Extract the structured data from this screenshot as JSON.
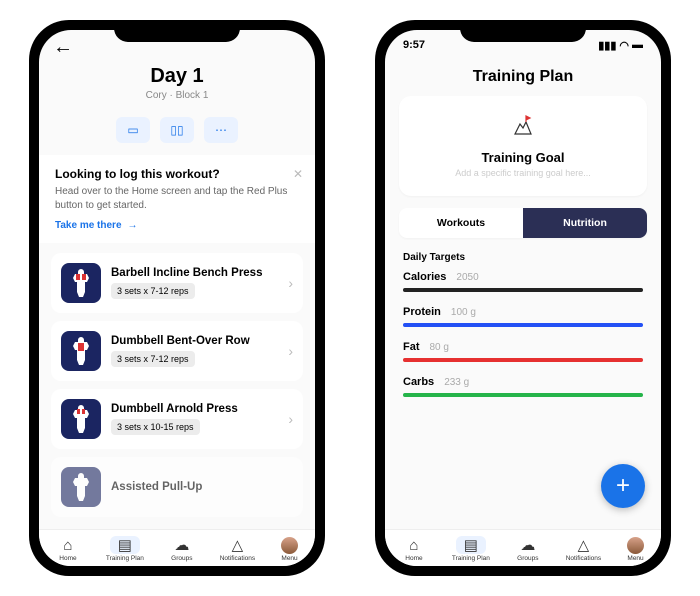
{
  "phone_a": {
    "title": "Day 1",
    "subtitle": "Cory · Block 1",
    "actions": {
      "video": "video-icon",
      "book": "book-icon",
      "more": "more-icon"
    },
    "banner": {
      "title": "Looking to log this workout?",
      "body": "Head over to the Home screen and tap the Red Plus button to get started.",
      "link_label": "Take me there"
    },
    "exercises": [
      {
        "name": "Barbell Incline Bench Press",
        "tag": "3 sets x 7-12 reps"
      },
      {
        "name": "Dumbbell Bent-Over Row",
        "tag": "3 sets x 7-12 reps"
      },
      {
        "name": "Dumbbell Arnold Press",
        "tag": "3 sets x 10-15 reps"
      },
      {
        "name": "Assisted Pull-Up",
        "tag": ""
      }
    ]
  },
  "phone_b": {
    "status_time": "9:57",
    "title": "Training Plan",
    "goal_card": {
      "title": "Training Goal",
      "placeholder": "Add a specific training goal here..."
    },
    "segments": {
      "workouts": "Workouts",
      "nutrition": "Nutrition"
    },
    "section_label": "Daily Targets",
    "targets": [
      {
        "name": "Calories",
        "amount": "2050",
        "bar_class": "bar-calories"
      },
      {
        "name": "Protein",
        "amount": "100 g",
        "bar_class": "bar-protein"
      },
      {
        "name": "Fat",
        "amount": "80 g",
        "bar_class": "bar-fat"
      },
      {
        "name": "Carbs",
        "amount": "233 g",
        "bar_class": "bar-carbs"
      }
    ]
  },
  "nav": {
    "items": [
      {
        "label": "Home",
        "icon": "home-icon"
      },
      {
        "label": "Training Plan",
        "icon": "clipboard-icon"
      },
      {
        "label": "Groups",
        "icon": "chat-icon"
      },
      {
        "label": "Notifications",
        "icon": "bell-icon"
      },
      {
        "label": "Menu",
        "icon": "avatar-icon"
      }
    ]
  }
}
